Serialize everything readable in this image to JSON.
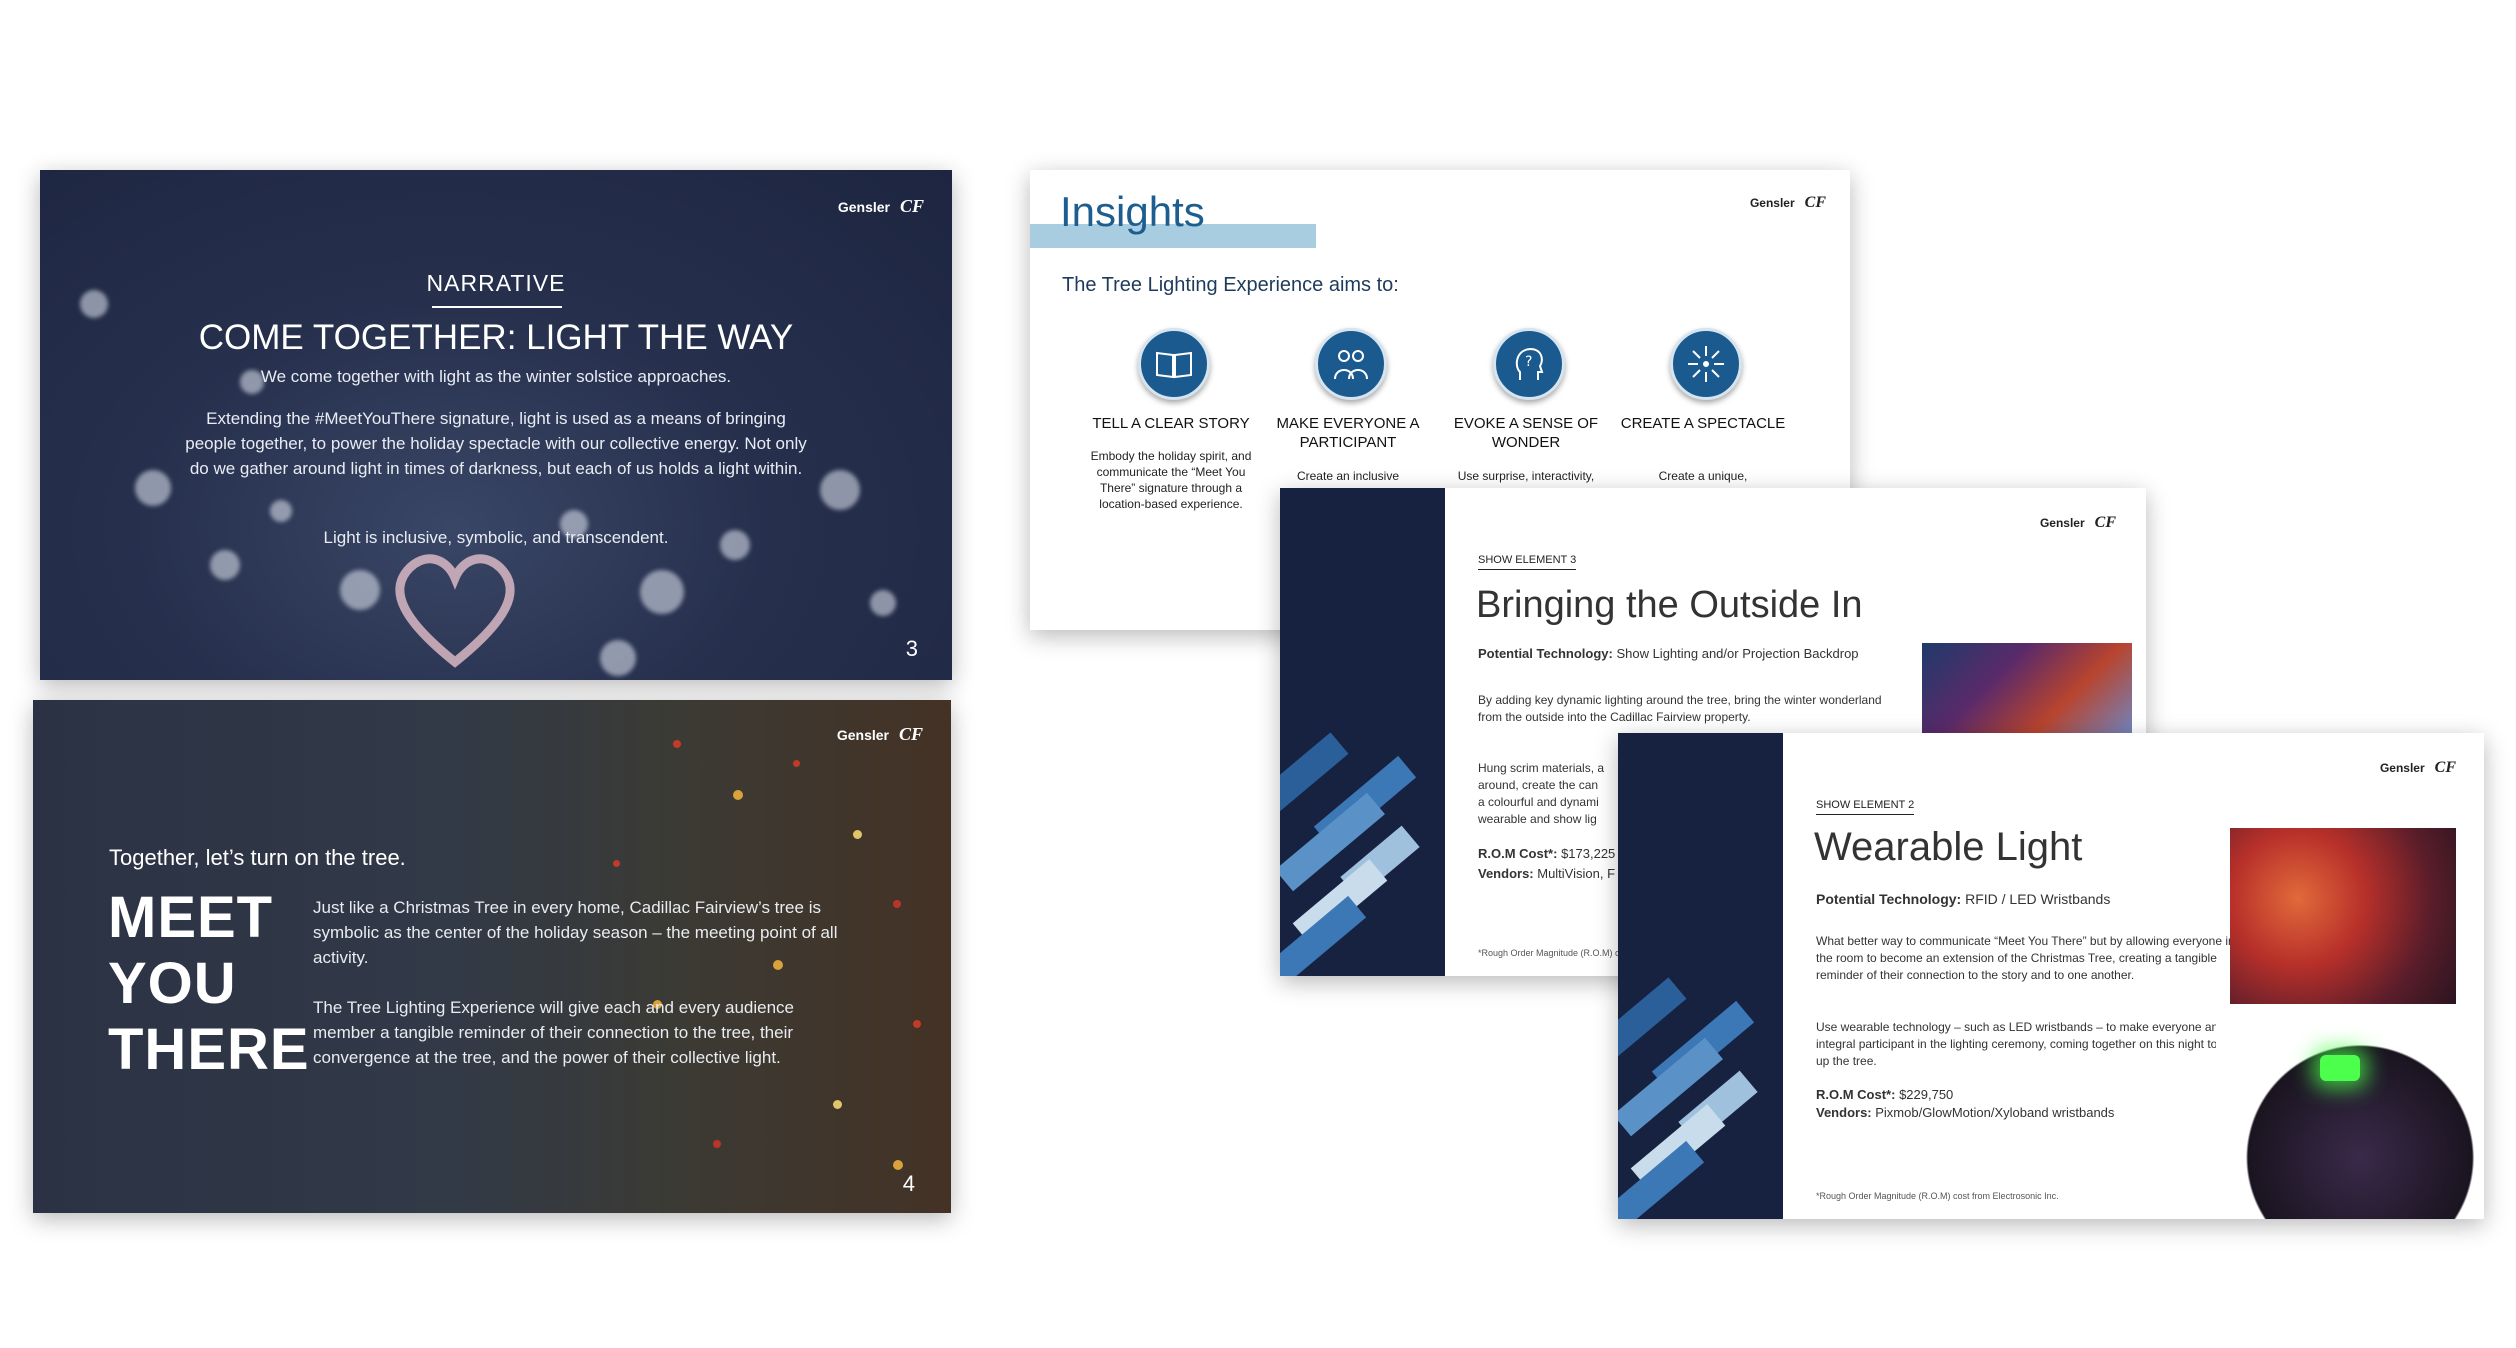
{
  "brand": {
    "logo_text": "Gensler",
    "logo_cf": "CF"
  },
  "slide_narrative": {
    "tag": "NARRATIVE",
    "title": "COME TOGETHER: LIGHT THE WAY",
    "p1": "We come together with light as the winter solstice approaches.",
    "p2": "Extending the #MeetYouThere signature, light is used as a means of bringing people together, to power the holiday spectacle with our collective energy. Not only do we gather around light in times of darkness, but each of us holds a light within.",
    "p3": "Light is inclusive, symbolic, and transcendent.",
    "page": "3"
  },
  "slide_meet": {
    "intro": "Together, let’s turn on the tree.",
    "big1": "MEET",
    "big2": "YOU",
    "big3": "THERE",
    "p1": "Just like a Christmas Tree in every home, Cadillac Fairview’s tree is symbolic as the center of the holiday season – the meeting point of all activity.",
    "p2": "The Tree Lighting Experience will give each and every audience member a tangible reminder of their connection to the tree, their convergence at the tree, and the power of their collective light.",
    "page": "4"
  },
  "slide_insights": {
    "title": "Insights",
    "subtitle": "The Tree Lighting Experience aims to:",
    "items": [
      {
        "icon": "book-icon",
        "head": "TELL A CLEAR STORY",
        "body": "Embody the holiday spirit, and communicate the “Meet You There” signature through a location-based experience."
      },
      {
        "icon": "people-icon",
        "head": "MAKE EVERYONE A PARTICIPANT",
        "body": "Create an inclusive"
      },
      {
        "icon": "head-question-icon",
        "head": "EVOKE A SENSE OF WONDER",
        "body": "Use surprise, interactivity,"
      },
      {
        "icon": "burst-icon",
        "head": "CREATE A SPECTACLE",
        "body": "Create a unique,"
      }
    ]
  },
  "slide_outside": {
    "tag": "SHOW ELEMENT 3",
    "title": "Bringing the Outside In",
    "tech_label": "Potential Technology:",
    "tech_value": " Show Lighting and/or Projection Backdrop",
    "p1": "By adding key dynamic lighting around the tree, bring the winter wonderland from the outside into the Cadillac Fairview property.",
    "p2a": "Hung scrim materials, a",
    "p2b": "around, create the can",
    "p2c": "a colourful and dynami",
    "p2d": "wearable and show lig",
    "cost_label": "R.O.M Cost*:",
    "cost_value": " $173,225",
    "vendors_label": "Vendors:",
    "vendors_value": " MultiVision, F",
    "foot": "*Rough Order Magnitude (R.O.M) c"
  },
  "slide_wearable": {
    "tag": "SHOW ELEMENT 2",
    "title": "Wearable Light",
    "tech_label": "Potential Technology:",
    "tech_value": " RFID / LED Wristbands",
    "p1": "What better way to communicate “Meet You There” but by allowing everyone in the room to become an extension of the Christmas Tree, creating a tangible reminder of their connection to the story and to one another.",
    "p2": "Use wearable technology – such as LED wristbands – to make everyone an integral participant in the lighting ceremony, coming together on this night to light up the tree.",
    "cost_label": "R.O.M Cost*:",
    "cost_value": " $229,750",
    "vendors_label": "Vendors:",
    "vendors_value": " Pixmob/GlowMotion/Xyloband wristbands",
    "foot": "*Rough Order Magnitude (R.O.M) cost from Electrosonic Inc."
  }
}
